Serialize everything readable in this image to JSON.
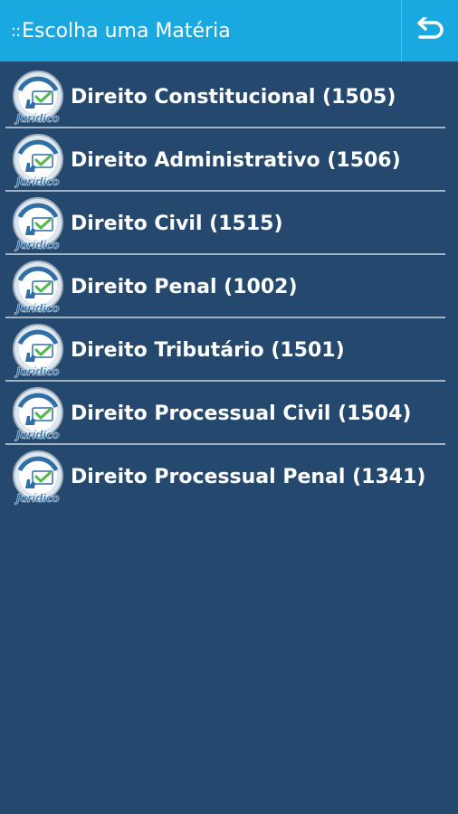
{
  "header": {
    "title_prefix": "::",
    "title": "Escolha uma Matéria",
    "back_icon": "back-arrow-icon"
  },
  "logo": {
    "arc_text": "Tá na mão",
    "brand_text": "Jurídico",
    "icon": "hand-checkmark-icon"
  },
  "subjects": [
    {
      "label": "Direito Constitucional (1505)"
    },
    {
      "label": "Direito Administrativo (1506)"
    },
    {
      "label": "Direito Civil (1515)"
    },
    {
      "label": "Direito Penal (1002)"
    },
    {
      "label": "Direito Tributário (1501)"
    },
    {
      "label": "Direito Processual Civil (1504)"
    },
    {
      "label": "Direito Processual Penal (1341)"
    }
  ],
  "colors": {
    "header_bg": "#1aa8e0",
    "page_bg": "#25496e",
    "text": "#ffffff",
    "separator": "#b8c6d4"
  }
}
